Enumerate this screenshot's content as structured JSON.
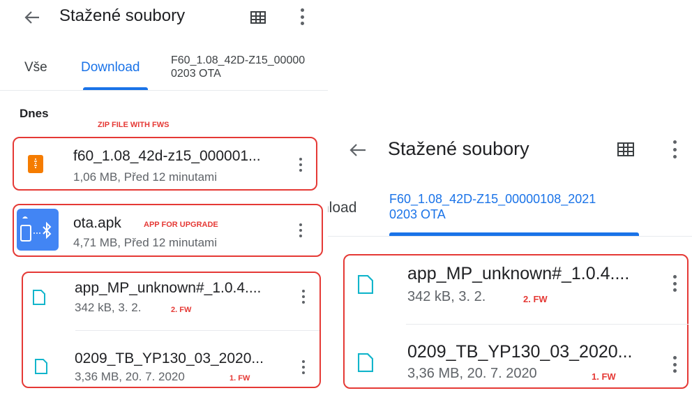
{
  "left": {
    "header": {
      "title": "Stažené soubory"
    },
    "tabs": [
      {
        "label": "Vše"
      },
      {
        "label": "Download"
      },
      {
        "label_line1": "F60_1.08_42D-Z15_00000",
        "label_line2": "0203 OTA"
      }
    ],
    "section": "Dnes",
    "annotations": {
      "zip": "ZIP FILE WITH FWS",
      "app": "APP FOR UPGRADE",
      "fw2": "2. FW",
      "fw1": "1. FW"
    },
    "files": [
      {
        "name": "f60_1.08_42d-z15_000001...",
        "meta": "1,06 MB, Před 12 minutami",
        "icon": "zip-icon"
      },
      {
        "name": "ota.apk",
        "meta": "4,71 MB, Před 12 minutami",
        "icon": "apk-icon"
      },
      {
        "name": "app_MP_unknown#_1.0.4....",
        "meta": "342 kB, 3. 2.",
        "icon": "file-icon"
      },
      {
        "name": "0209_TB_YP130_03_2020...",
        "meta": "3,36 MB, 20. 7. 2020",
        "icon": "file-icon"
      }
    ]
  },
  "right": {
    "header": {
      "title": "Stažené soubory"
    },
    "tabs": [
      {
        "label": "nload"
      },
      {
        "label_line1": "F60_1.08_42D-Z15_00000108_2021",
        "label_line2": "0203 OTA"
      }
    ],
    "annotations": {
      "fw2": "2. FW",
      "fw1": "1. FW"
    },
    "files": [
      {
        "name": "app_MP_unknown#_1.0.4....",
        "meta": "342 kB, 3. 2.",
        "icon": "file-icon"
      },
      {
        "name": "0209_TB_YP130_03_2020...",
        "meta": "3,36 MB, 20. 7. 2020",
        "icon": "file-icon"
      }
    ]
  },
  "colors": {
    "accent": "#1a73e8",
    "annotation": "#e53935",
    "zip_icon": "#f57c00",
    "apk_bg": "#4285f4",
    "file_icon": "#12b5cb"
  }
}
